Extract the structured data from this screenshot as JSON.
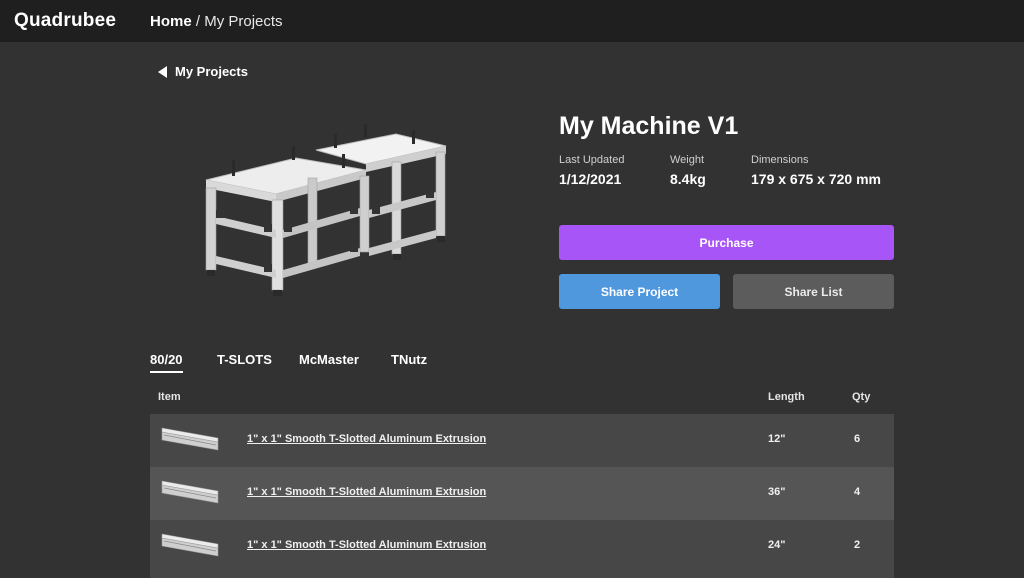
{
  "header": {
    "logo": "Quadrubee",
    "breadcrumb": {
      "home": "Home",
      "separator": " / ",
      "current": "My Projects"
    }
  },
  "back_link": {
    "label": "My Projects"
  },
  "product": {
    "title": "My Machine V1",
    "meta": [
      {
        "label": "Last Updated",
        "value": "1/12/2021"
      },
      {
        "label": "Weight",
        "value": "8.4kg"
      },
      {
        "label": "Dimensions",
        "value": "179 x 675 x 720 mm"
      }
    ],
    "image_icon": "machine-frame-render"
  },
  "actions": {
    "purchase": "Purchase",
    "share_project": "Share Project",
    "share_list": "Share List"
  },
  "tabs": [
    {
      "label": "80/20",
      "active": true
    },
    {
      "label": "T-SLOTS",
      "active": false
    },
    {
      "label": "McMaster",
      "active": false
    },
    {
      "label": "TNutz",
      "active": false
    }
  ],
  "table": {
    "headers": {
      "item": "Item",
      "length": "Length",
      "qty": "Qty"
    },
    "rows": [
      {
        "name": "1\" x 1\" Smooth T-Slotted Aluminum Extrusion",
        "length": "12\"",
        "qty": "6"
      },
      {
        "name": "1\" x 1\" Smooth T-Slotted Aluminum Extrusion",
        "length": "36\"",
        "qty": "4"
      },
      {
        "name": "1\" x 1\" Smooth T-Slotted Aluminum Extrusion",
        "length": "24\"",
        "qty": "2"
      }
    ]
  },
  "colors": {
    "background": "#333232",
    "topbar": "#1f1f1f",
    "purchase": "#a855f7",
    "share_project": "#4f98de",
    "share_list": "#5c5c5c",
    "row_odd": "#474747",
    "row_even": "#555555"
  }
}
